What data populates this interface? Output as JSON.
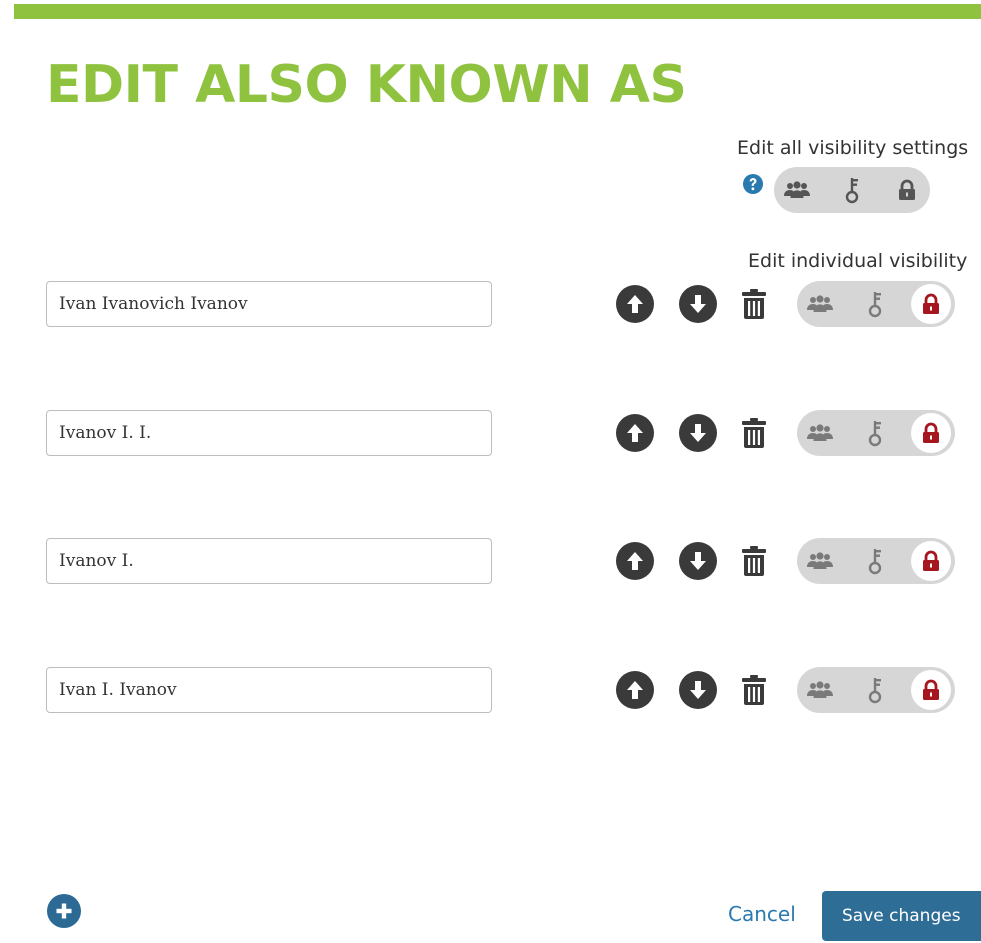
{
  "modal": {
    "title": "EDIT ALSO KNOWN AS",
    "accent_color": "#8fc33f"
  },
  "visibility": {
    "all_label": "Edit all visibility settings",
    "individual_label": "Edit individual visibility"
  },
  "names": [
    {
      "value": "Ivan Ivanovich Ivanov",
      "visibility": "private"
    },
    {
      "value": "Ivanov I. I.",
      "visibility": "private"
    },
    {
      "value": "Ivanov I.",
      "visibility": "private"
    },
    {
      "value": "Ivan I. Ivanov",
      "visibility": "private"
    }
  ],
  "icons": {
    "help": "question-circle-icon",
    "public": "users-icon",
    "limited": "key-icon",
    "private": "lock-icon",
    "move_up": "arrow-up-circle-icon",
    "move_down": "arrow-down-circle-icon",
    "delete": "trash-icon",
    "add": "plus-circle-icon"
  },
  "colors": {
    "private_active": "#a5161f",
    "link": "#2a7ab0",
    "primary_button": "#2e6d96"
  },
  "footer": {
    "cancel_label": "Cancel",
    "save_label": "Save changes"
  }
}
